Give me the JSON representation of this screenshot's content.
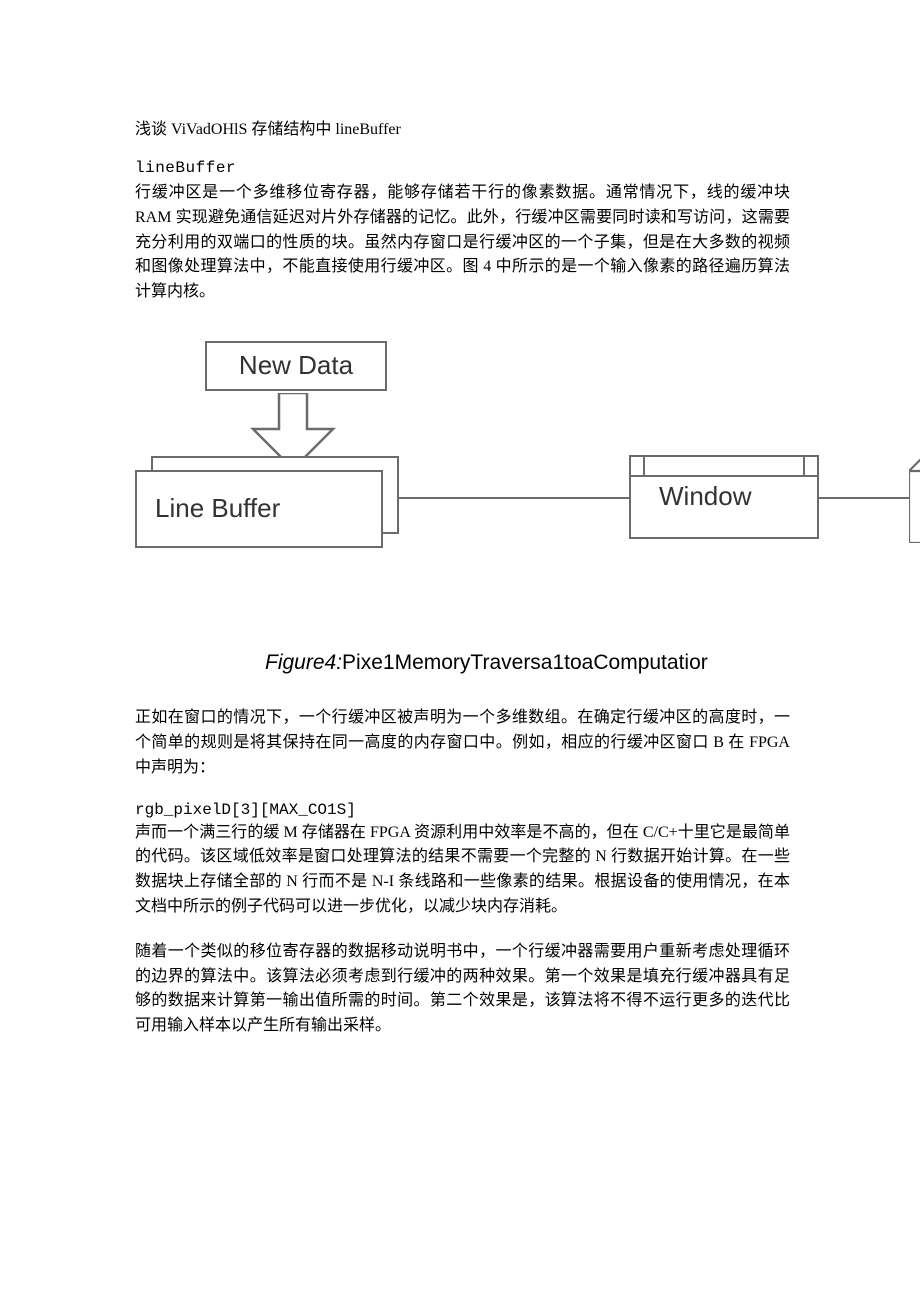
{
  "title": "浅谈 ViVadOHlS 存储结构中 lineBuffer",
  "section_heading": "lineBuffer",
  "para1": "行缓冲区是一个多维移位寄存器，能够存储若干行的像素数据。通常情况下，线的缓冲块 RAM 实现避免通信延迟对片外存储器的记忆。此外，行缓冲区需要同时读和写访问，这需要充分利用的双端口的性质的块。虽然内存窗口是行缓冲区的一个子集，但是在大多数的视频和图像处理算法中，不能直接使用行缓冲区。图 4 中所示的是一个输入像素的路径遍历算法计算内核。",
  "diagram": {
    "new_data_label": "New Data",
    "line_buffer_label": "Line Buffer",
    "window_label": "Window"
  },
  "caption_prefix": "Figure4:",
  "caption_text": "Pixe1MemoryTraversa1toaComputatior",
  "para2": "正如在窗口的情况下，一个行缓冲区被声明为一个多维数组。在确定行缓冲区的高度时，一个简单的规则是将其保持在同一高度的内存窗口中。例如，相应的行缓冲区窗口 B 在 FPGA 中声明为：",
  "code_line": "rgb_pixelD[3][MAX_CO1S]",
  "para3": "声而一个满三行的缓 M 存储器在 FPGA 资源利用中效率是不高的，但在 C/C+十里它是最简单的代码。该区域低效率是窗口处理算法的结果不需要一个完整的 N 行数据开始计算。在一些数据块上存储全部的 N 行而不是 N-I 条线路和一些像素的结果。根据设备的使用情况，在本文档中所示的例子代码可以进一步优化，以减少块内存消耗。",
  "para4": "随着一个类似的移位寄存器的数据移动说明书中，一个行缓冲器需要用户重新考虑处理循环的边界的算法中。该算法必须考虑到行缓冲的两种效果。第一个效果是填充行缓冲器具有足够的数据来计算第一输出值所需的时间。第二个效果是，该算法将不得不运行更多的迭代比可用输入样本以产生所有输出采样。"
}
